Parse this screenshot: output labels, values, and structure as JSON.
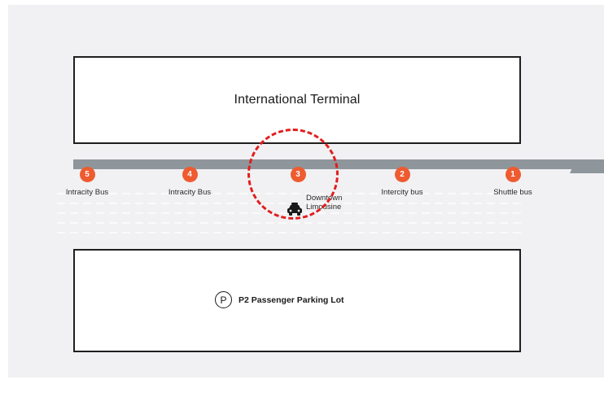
{
  "terminal": {
    "name": "International Terminal"
  },
  "parking": {
    "symbol": "P",
    "name": "P2 Passenger Parking Lot"
  },
  "stops": [
    {
      "number": "5",
      "name": "Intracity Bus"
    },
    {
      "number": "4",
      "name": "Intracity Bus"
    },
    {
      "number": "3",
      "name": "Downtown Limousine",
      "icon": "car-icon"
    },
    {
      "number": "2",
      "name": "Intercity bus"
    },
    {
      "number": "1",
      "name": "Shuttle bus"
    }
  ],
  "colors": {
    "stop_badge": "#ee5b30",
    "road": "#8f969b",
    "highlight": "#e21d1d",
    "background": "#f1f1f3"
  }
}
